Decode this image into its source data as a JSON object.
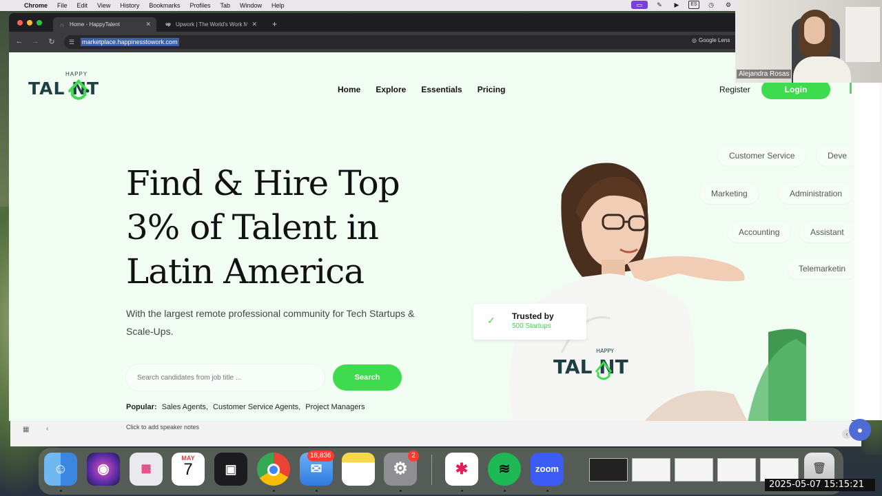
{
  "menubar": {
    "app": "Chrome",
    "items": [
      "File",
      "Edit",
      "View",
      "History",
      "Bookmarks",
      "Profiles",
      "Tab",
      "Window",
      "Help"
    ],
    "input_source": "ES"
  },
  "browser": {
    "tabs": [
      {
        "title": "Home - HappyTalent",
        "active": true
      },
      {
        "title": "Upwork | The World's Work Ma",
        "active": false
      }
    ],
    "url": "marketplace.happinesstowork.com",
    "lens_label": "Google Lens"
  },
  "site": {
    "logo_small": "HAPPY",
    "logo_main": "TAL  NT",
    "nav": [
      "Home",
      "Explore",
      "Essentials",
      "Pricing"
    ],
    "register": "Register",
    "login": "Login",
    "hero_lines": [
      "Find & Hire Top",
      "3% of Talent in",
      "Latin America"
    ],
    "hero_sub": "With the largest remote professional community for Tech Startups & Scale-Ups.",
    "search_placeholder": "Search candidates from job title ...",
    "search_button": "Search",
    "popular_label": "Popular:",
    "popular_items": [
      "Sales Agents,",
      "Customer Service Agents,",
      "Project Managers"
    ],
    "badge_title": "Trusted by",
    "badge_sub": "500 Startups",
    "chips": [
      "Customer Service",
      "Deve",
      "Marketing",
      "Administration",
      "Accounting",
      "Assistant",
      "Telemarketin"
    ],
    "shirt_small": "HAPPY",
    "shirt_main": "TAL  NT"
  },
  "slides": {
    "notes_placeholder": "Click to add speaker notes"
  },
  "video": {
    "participant": "Alejandra Rosas"
  },
  "dock": {
    "calendar_month": "MAY",
    "calendar_day": "7",
    "mail_badge": "18,836",
    "settings_badge": "2",
    "zoom_label": "zoom"
  },
  "timestamp": "2025-05-07  15:15:21",
  "colors": {
    "accent": "#3ddb4d",
    "brand_dark": "#1f3f44",
    "page_bg": "#f1fcf3"
  }
}
